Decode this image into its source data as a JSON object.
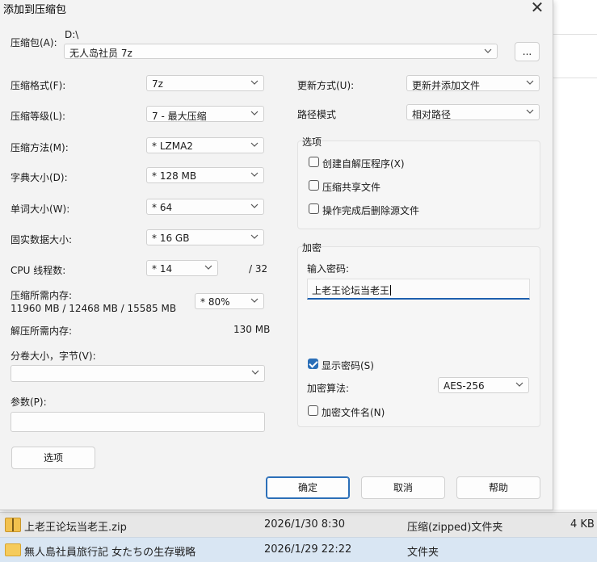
{
  "dialog": {
    "title": "添加到压缩包",
    "archive": {
      "label": "压缩包(A):",
      "path": "D:\\",
      "name": "无人岛社员 7z",
      "browse": "..."
    },
    "left": {
      "format": {
        "label": "压缩格式(F):",
        "value": "7z"
      },
      "level": {
        "label": "压缩等级(L):",
        "value": "7 - 最大压缩"
      },
      "method": {
        "label": "压缩方法(M):",
        "value": "* LZMA2"
      },
      "dict": {
        "label": "字典大小(D):",
        "value": "* 128 MB"
      },
      "word": {
        "label": "单词大小(W):",
        "value": "* 64"
      },
      "solid": {
        "label": "固实数据大小:",
        "value": "* 16 GB"
      },
      "cpu": {
        "label": "CPU 线程数:",
        "value": "* 14",
        "total": "/ 32"
      },
      "mem_compress": {
        "label": "压缩所需内存:",
        "detail": "11960 MB / 12468 MB / 15585 MB",
        "value": "* 80%"
      },
      "mem_decompress": {
        "label": "解压所需内存:",
        "value": "130 MB"
      },
      "split": {
        "label": "分卷大小，字节(V):",
        "value": ""
      },
      "params": {
        "label": "参数(P):",
        "value": ""
      },
      "options_btn": "选项"
    },
    "right": {
      "update": {
        "label": "更新方式(U):",
        "value": "更新并添加文件"
      },
      "path_mode": {
        "label": "路径模式",
        "value": "相对路径"
      },
      "options_group": {
        "title": "选项",
        "items": [
          {
            "label": "创建自解压程序(X)",
            "checked": false
          },
          {
            "label": "压缩共享文件",
            "checked": false
          },
          {
            "label": "操作完成后删除源文件",
            "checked": false
          }
        ]
      },
      "encrypt_group": {
        "title": "加密",
        "password_label": "输入密码:",
        "password": "上老王论坛当老王",
        "show_password": {
          "label": "显示密码(S)",
          "checked": true
        },
        "method_label": "加密算法:",
        "method_value": "AES-256",
        "encrypt_names": {
          "label": "加密文件名(N)",
          "checked": false
        }
      }
    },
    "buttons": {
      "ok": "确定",
      "cancel": "取消",
      "help": "帮助"
    }
  },
  "files": [
    {
      "name": "上老王论坛当老王.zip",
      "date": "2026/1/30 8:30",
      "type": "压缩(zipped)文件夹",
      "size": "4 KB"
    },
    {
      "name": "無人島社員旅行記 女たちの生存戦略",
      "date": "2026/1/29 22:22",
      "type": "文件夹",
      "size": ""
    }
  ],
  "colors": {
    "accent": "#2b6fb8",
    "selected_row": "#d9e6f3"
  }
}
